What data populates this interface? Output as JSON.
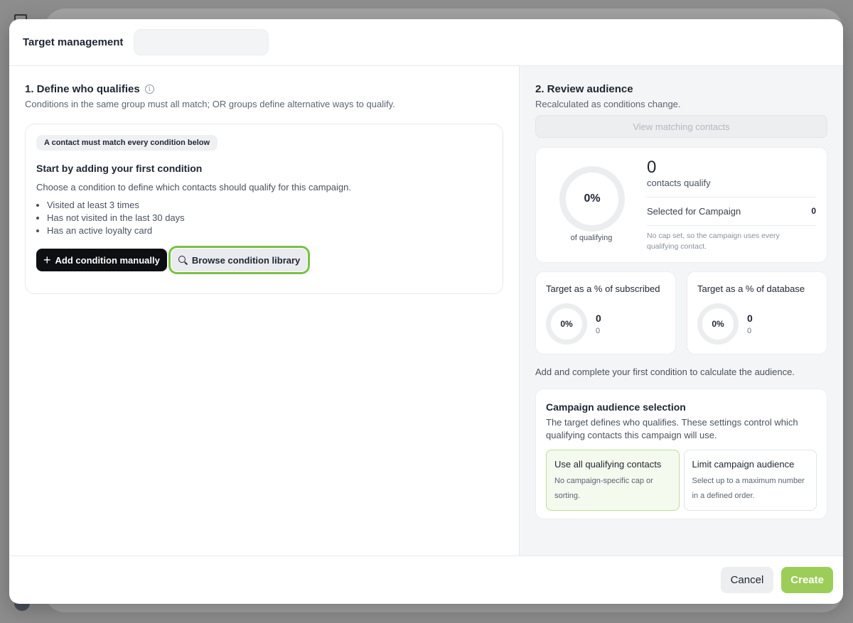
{
  "header": {
    "title": "Target management"
  },
  "define": {
    "title": "1. Define who qualifies",
    "subtitle": "Conditions in the same group must all match; OR groups define alternative ways to qualify.",
    "chip": "A contact must match every condition below",
    "heading": "Start by adding your first condition",
    "description": "Choose a condition to define which contacts should qualify for this campaign.",
    "examples": [
      "Visited at least 3 times",
      "Has not visited in the last 30 days",
      "Has an active loyalty card"
    ],
    "add_label": "Add condition manually",
    "browse_label": "Browse condition library"
  },
  "review": {
    "title": "2. Review audience",
    "subtitle": "Recalculated as conditions change.",
    "view_label": "View matching contacts",
    "donut_value": "0%",
    "donut_caption": "of qualifying",
    "count": "0",
    "count_label": "contacts qualify",
    "selected_label": "Selected for Campaign",
    "selected_value": "0",
    "cap_note": "No cap set, so the campaign uses every qualifying contact.",
    "subscribed": {
      "title": "Target as a % of subscribed",
      "pct": "0%",
      "value": "0",
      "sub": "0"
    },
    "database": {
      "title": "Target as a % of database",
      "pct": "0%",
      "value": "0",
      "sub": "0"
    },
    "hint": "Add and complete your first condition to calculate the audience."
  },
  "audience": {
    "title": "Campaign audience selection",
    "description": "The target defines who qualifies. These settings control which qualifying contacts this campaign will use.",
    "options": [
      {
        "title": "Use all qualifying contacts",
        "desc": "No campaign-specific cap or sorting."
      },
      {
        "title": "Limit campaign audience",
        "desc": "Select up to a maximum number in a defined order."
      }
    ]
  },
  "footer": {
    "cancel_label": "Cancel",
    "create_label": "Create"
  },
  "colors": {
    "accent": "#9ccd58",
    "focus": "#7bc043",
    "dark": "#0d0f12"
  }
}
